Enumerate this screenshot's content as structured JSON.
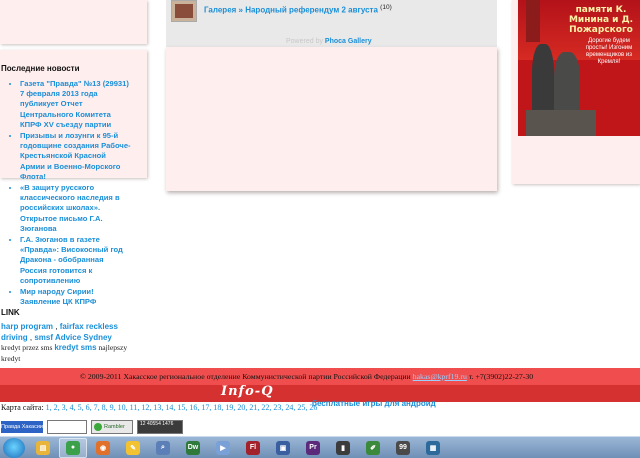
{
  "gallery": {
    "link_text": "Галерея » Народный референдум 2 августа",
    "count": "(10)",
    "powered_prefix": "Powered by",
    "powered_link": "Phoca Gallery"
  },
  "news": {
    "title": "Последние новости",
    "items": [
      "Газета \"Правда\" №13 (29931) 7 февраля 2013 года публикует Отчет Центрального Комитета КПРФ XV съезду партии",
      "Призывы и лозунги к 95-й годовщине создания Рабоче-Крестьянской Красной Армии и Военно-Морского Флота!",
      "«В защиту русского классического наследия в российских школах». Открытое письмо Г.А. Зюганова",
      "Г.А. Зюганов в газете «Правда»: Високосный год Дракона - обобранная Россия готовится к сопротивлению",
      "Мир народу Сирии! Заявление ЦК КПРФ"
    ]
  },
  "links": {
    "title": "LINK",
    "line1": "harp program",
    "line1_sep": " , ",
    "line1b": "fairfax reckless driving",
    "line1c": " , ",
    "line1d": "smsf Advice Sydney",
    "line2a": "kredyt przez sms ",
    "line2b": "kredyt sms",
    "line2c": " najlepszy kredyt"
  },
  "poster": {
    "headline": "памяти К. Минина и Д. Пожарского",
    "caption": "Дорогие будем просты! Изгоним временщиков из Кремля!"
  },
  "footer": {
    "copyright": "© 2009-2011 Хакасское региональное отделение Коммунистической партии Российской Федерации",
    "email": "hakas@kprf19.ru",
    "phone": " т. +7(3902)22-27-30",
    "logo": "Info-Q",
    "overlap_link": "бесплатные игры для андроид",
    "sitemap_label": "Карта сайта: ",
    "sitemap_pages": [
      "1",
      "2",
      "3",
      "4",
      "5",
      "6",
      "7",
      "8",
      "9",
      "10",
      "11",
      "12",
      "13",
      "14",
      "15",
      "16",
      "17",
      "18",
      "19",
      "20",
      "21",
      "22",
      "23",
      "24",
      "25",
      "26"
    ]
  },
  "counters": {
    "c1": "Правда Хакасии",
    "c3": "Rambler TOP100",
    "c4": "12 40554 1476"
  },
  "taskbar": {
    "items": [
      {
        "name": "explorer-icon",
        "color": "#e8b43a",
        "glyph": "▤"
      },
      {
        "name": "chrome-icon",
        "color": "#3aa04a",
        "glyph": "●"
      },
      {
        "name": "firefox-icon",
        "color": "#e0702a",
        "glyph": "◉"
      },
      {
        "name": "notes-icon",
        "color": "#f2c230",
        "glyph": "✎"
      },
      {
        "name": "search-icon",
        "color": "#5c7fb8",
        "glyph": "⌕"
      },
      {
        "name": "dreamweaver-icon",
        "color": "#2f7a3a",
        "glyph": "Dw"
      },
      {
        "name": "media-icon",
        "color": "#7aa0d8",
        "glyph": "▶"
      },
      {
        "name": "flash-icon",
        "color": "#a3212a",
        "glyph": "Fl"
      },
      {
        "name": "save-icon",
        "color": "#3a5fa0",
        "glyph": "▣"
      },
      {
        "name": "premiere-icon",
        "color": "#5b2a7a",
        "glyph": "Pr"
      },
      {
        "name": "terminal-icon",
        "color": "#3c3c3c",
        "glyph": "▮"
      },
      {
        "name": "edit-icon",
        "color": "#3b8a3b",
        "glyph": "✐"
      },
      {
        "name": "media-player-icon",
        "color": "#4a4a4a",
        "glyph": "99"
      },
      {
        "name": "table-icon",
        "color": "#2c6a9c",
        "glyph": "▦"
      }
    ]
  }
}
